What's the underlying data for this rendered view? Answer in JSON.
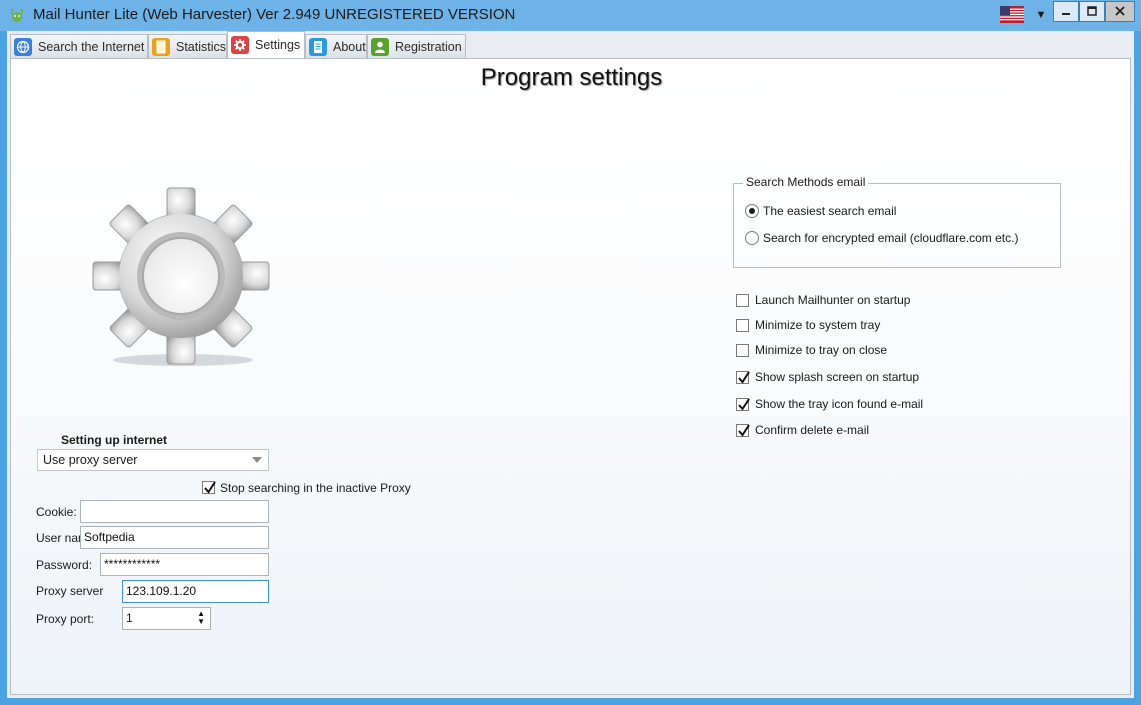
{
  "window": {
    "title": "Mail Hunter Lite (Web Harvester)  Ver 2.949   UNREGISTERED VERSION"
  },
  "tabs": [
    {
      "label": "Search the Internet",
      "icon": "globe-icon",
      "color": "#3b82d6"
    },
    {
      "label": "Statistics",
      "icon": "statistics-icon",
      "color": "#e8a21c"
    },
    {
      "label": "Settings",
      "icon": "gear-icon",
      "color": "#d94545",
      "active": true
    },
    {
      "label": "About",
      "icon": "document-icon",
      "color": "#2b9bd8"
    },
    {
      "label": "Registration",
      "icon": "user-icon",
      "color": "#5aa02c"
    }
  ],
  "page_title": "Program settings",
  "internet": {
    "section_label": "Setting up internet",
    "proxy_mode": "Use proxy server",
    "stop_inactive_proxy": {
      "label": "Stop searching in the inactive Proxy",
      "checked": true
    },
    "cookie": {
      "label": "Cookie:",
      "value": ""
    },
    "username": {
      "label": "User name",
      "value": "Softpedia"
    },
    "password": {
      "label": "Password:",
      "value": "************"
    },
    "proxy_server": {
      "label": "Proxy server",
      "value": "123.109.1.20"
    },
    "proxy_port": {
      "label": "Proxy port:",
      "value": "1"
    }
  },
  "search_methods": {
    "title": "Search Methods email",
    "options": [
      {
        "label": "The easiest search email",
        "selected": true
      },
      {
        "label": "Search for encrypted email (cloudflare.com etc.)",
        "selected": false
      }
    ]
  },
  "options": [
    {
      "label": "Launch Mailhunter on startup",
      "checked": false
    },
    {
      "label": "Minimize to system tray",
      "checked": false
    },
    {
      "label": "Minimize to tray on close",
      "checked": false
    },
    {
      "label": "Show splash screen on startup",
      "checked": true
    },
    {
      "label": "Show the tray icon found e-mail",
      "checked": true
    },
    {
      "label": "Confirm delete e-mail",
      "checked": true
    }
  ]
}
